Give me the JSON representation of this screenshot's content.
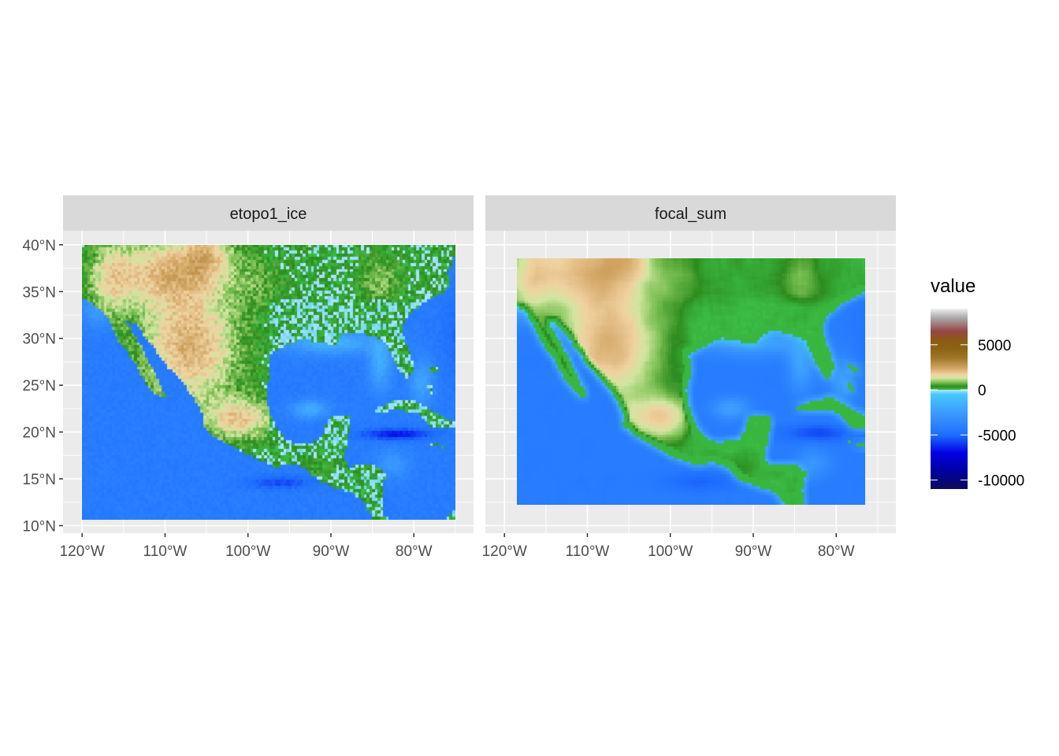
{
  "panels": [
    {
      "title": "etopo1_ice",
      "smooth": false
    },
    {
      "title": "focal_sum",
      "smooth": true
    }
  ],
  "axes": {
    "x_ticks": [
      {
        "value": -120,
        "label": "120°W"
      },
      {
        "value": -110,
        "label": "110°W"
      },
      {
        "value": -100,
        "label": "100°W"
      },
      {
        "value": -90,
        "label": "90°W"
      },
      {
        "value": -80,
        "label": "80°W"
      }
    ],
    "y_ticks": [
      {
        "value": 40,
        "label": "40°N"
      },
      {
        "value": 35,
        "label": "35°N"
      },
      {
        "value": 30,
        "label": "30°N"
      },
      {
        "value": 25,
        "label": "25°N"
      },
      {
        "value": 20,
        "label": "20°N"
      },
      {
        "value": 15,
        "label": "15°N"
      },
      {
        "value": 10,
        "label": "10°N"
      }
    ],
    "xlim": [
      -122.3,
      -72.8
    ],
    "ylim": [
      9.2,
      41.5
    ]
  },
  "legend": {
    "title": "value",
    "labels": [
      {
        "value": 5000,
        "label": "5000"
      },
      {
        "value": 0,
        "label": "0"
      },
      {
        "value": -5000,
        "label": "-5000"
      },
      {
        "value": -10000,
        "label": "-10000"
      }
    ],
    "range": [
      -11000,
      9000
    ],
    "stops": [
      {
        "value": -11000,
        "color": "#0c0c5a"
      },
      {
        "value": -9000,
        "color": "#0000a0"
      },
      {
        "value": -7000,
        "color": "#0000e6"
      },
      {
        "value": -5000,
        "color": "#1e6eff"
      },
      {
        "value": -2500,
        "color": "#3c9bff"
      },
      {
        "value": -500,
        "color": "#46c8ff"
      },
      {
        "value": 0,
        "color": "#b4e6ff"
      },
      {
        "value": 1,
        "color": "#3cbe46"
      },
      {
        "value": 400,
        "color": "#2d8c1e"
      },
      {
        "value": 800,
        "color": "#78be50"
      },
      {
        "value": 1300,
        "color": "#d2e6a0"
      },
      {
        "value": 1700,
        "color": "#f0d2a0"
      },
      {
        "value": 2400,
        "color": "#d2a564"
      },
      {
        "value": 3500,
        "color": "#a07828"
      },
      {
        "value": 4500,
        "color": "#8c6414"
      },
      {
        "value": 5500,
        "color": "#8c5a14"
      },
      {
        "value": 6500,
        "color": "#964646"
      },
      {
        "value": 8000,
        "color": "#aaaaaa"
      },
      {
        "value": 9000,
        "color": "#f0f0f0"
      }
    ]
  },
  "colors": {
    "panel_bg": "#ebebeb",
    "strip_bg": "#d9d9d9",
    "grid": "#ffffff",
    "tick": "#333333"
  }
}
